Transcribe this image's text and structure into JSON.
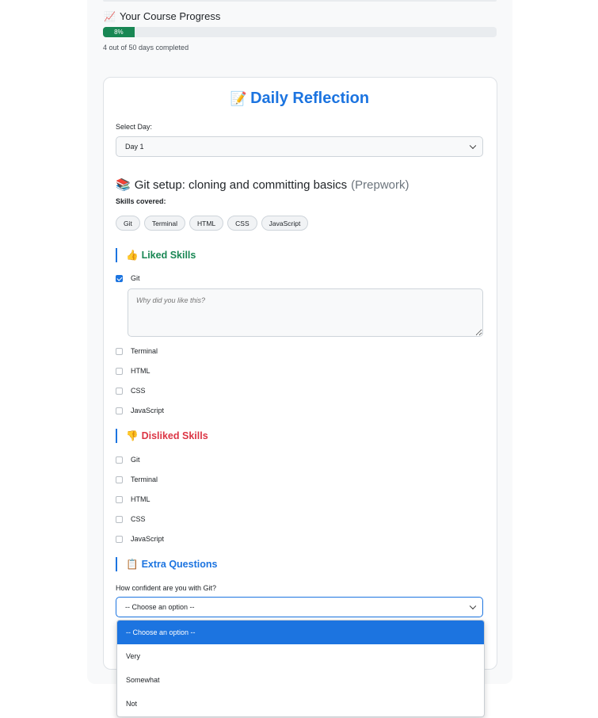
{
  "progress": {
    "emoji": "📈",
    "title": "Your Course Progress",
    "percent_label": "8%",
    "fraction": 0.08,
    "caption": "4 out of 50 days completed",
    "fill_color": "#198754"
  },
  "reflection": {
    "emoji": "📝",
    "title": "Daily Reflection",
    "day_label": "Select Day:",
    "day_value": "Day 1",
    "lesson": {
      "emoji": "📚",
      "title": "Git setup: cloning and committing basics",
      "tag": "(Prepwork)"
    },
    "skills_label": "Skills covered:",
    "skills": [
      "Git",
      "Terminal",
      "HTML",
      "CSS",
      "JavaScript"
    ]
  },
  "liked": {
    "emoji": "👍",
    "title": "Liked Skills",
    "color": "#198754",
    "items": [
      {
        "label": "Git",
        "checked": true
      },
      {
        "label": "Terminal",
        "checked": false
      },
      {
        "label": "HTML",
        "checked": false
      },
      {
        "label": "CSS",
        "checked": false
      },
      {
        "label": "JavaScript",
        "checked": false
      }
    ],
    "reason_placeholder": "Why did you like this?"
  },
  "disliked": {
    "emoji": "👎",
    "title": "Disliked Skills",
    "color": "#dc3545",
    "items": [
      {
        "label": "Git",
        "checked": false
      },
      {
        "label": "Terminal",
        "checked": false
      },
      {
        "label": "HTML",
        "checked": false
      },
      {
        "label": "CSS",
        "checked": false
      },
      {
        "label": "JavaScript",
        "checked": false
      }
    ]
  },
  "extra": {
    "emoji": "📋",
    "title": "Extra Questions",
    "color": "#1c74e0",
    "question": "How confident are you with Git?",
    "selected": "-- Choose an option --",
    "options": [
      "-- Choose an option --",
      "Very",
      "Somewhat",
      "Not"
    ]
  },
  "colors": {
    "accent": "#1c74e0"
  }
}
